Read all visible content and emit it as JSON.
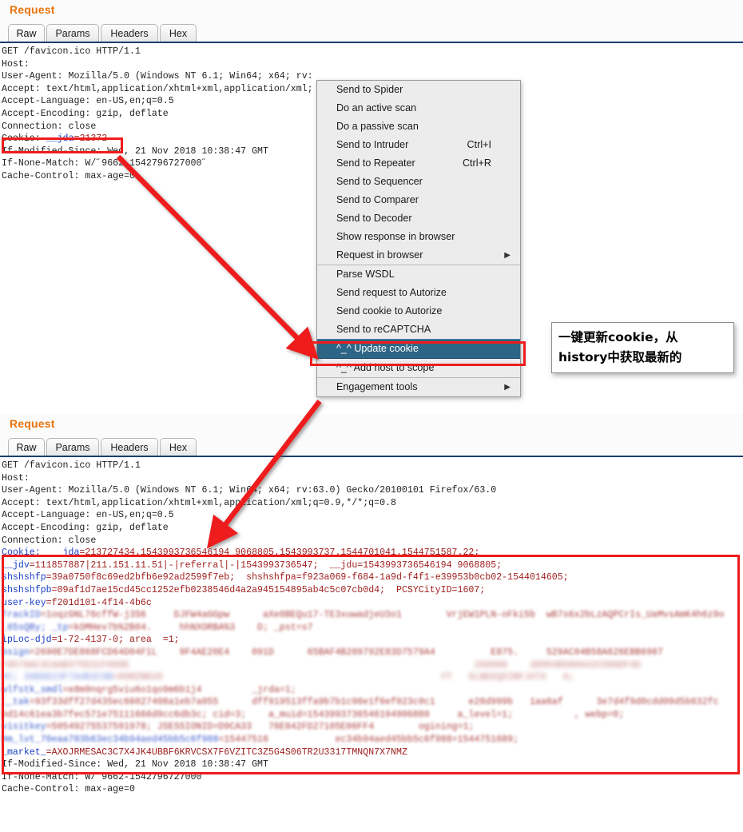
{
  "panels": {
    "top": {
      "title": "Request",
      "tabs": [
        {
          "label": "Raw",
          "active": true
        },
        {
          "label": "Params",
          "active": false
        },
        {
          "label": "Headers",
          "active": false
        },
        {
          "label": "Hex",
          "active": false
        }
      ],
      "raw_lines": [
        "GET /favicon.ico HTTP/1.1",
        "Host:",
        "User-Agent: Mozilla/5.0 (Windows NT 6.1; Win64; x64; rv:",
        "Accept: text/html,application/xhtml+xml,application/xml;",
        "Accept-Language: en-US,en;q=0.5",
        "Accept-Encoding: gzip, deflate",
        "Connection: close"
      ],
      "cookie_label": "Cookie: ",
      "cookie_name": "__jda",
      "cookie_eq": "=",
      "cookie_value": "21372",
      "tail_lines": [
        "If-Modified-Since: Wed, 21 Nov 2018 10:38:47 GMT",
        "If-None-Match: W/˝9662-1542796727000˝",
        "Cache-Control: max-age=0"
      ]
    },
    "bottom": {
      "title": "Request",
      "tabs": [
        {
          "label": "Raw",
          "active": true
        },
        {
          "label": "Params",
          "active": false
        },
        {
          "label": "Headers",
          "active": false
        },
        {
          "label": "Hex",
          "active": false
        }
      ],
      "raw_lines": [
        "GET /favicon.ico HTTP/1.1",
        "Host:",
        "User-Agent: Mozilla/5.0 (Windows NT 6.1; Win64; x64; rv:63.0) Gecko/20100101 Firefox/63.0",
        "Accept: text/html,application/xhtml+xml,application/xml;q=0.9,*/*;q=0.8",
        "Accept-Language: en-US,en;q=0.5",
        "Accept-Encoding: gzip, deflate",
        "Connection: close"
      ],
      "cookie_lines": [
        "Cookie:  __jda=213727434.1543993736546194 9068805.1543993737.1544701041.1544751587.22;",
        "__jdv=111857887|211.151.11.51|-|referral|-|1543993736547;  __jdu=1543993736546194 9068805;",
        "shshshfp=39a0750f8c69ed2bfb6e92ad2599f7eb;  shshshfpa=f923a069-f684-1a9d-f4f1-e39953b0cb02-1544014605;",
        "shshshfpb=09af1d7ae15cd45cc1252efb0238546d4a2a945154895ab4c5c07cb0d4;  PCSYCityID=1607;",
        "user-key=f201d101-4f14-4b6c",
        "TrackID=1oqzGNL76cffW-j3S6     DJFW4aGGpw      aXe8BEQu17-TE3xuwadjeU3o1        VrjEW1PLN-oFki5b  wB7s6x2bLzAQPCrIs_UaMvsAmK4h6z9o",
        "_65sQBy; _tp=kOMHev7b%2B04.     hhNXORBA%3    D; _pst=s7",
        "ipLoc-djd=1-72-4137-0; area  =1;",
        "bsign=2690E7DE868FCD64D04F1L    9F4AE20E4    091D      65BAF4B209792E83D7579A4          E875.     529AC04B58A626EBB6987",
        "F8578AC3CAAB375D1CF668E                                                              268006    38004B580A42C50ADF4D",
        "8C; 3AB9D23F7A4B3C9B=0SRZNEUX                                                  YT   5LBEEQXIBFJXTX   A;",
        "wlfstk_smdl=e8m9nqrg5viu6o1qo9m6b1j4         _jrda=1;",
        "__tak=93f33dff27d435ec66027408a1eb7a055      dff919513ffa9b7b1c98e1f6ef023c0c1      e28d999b   1aa6af      3e7d4f9d0cdd09d5b632fc",
        "bd14c61ea3b7fec571e75111666d9cc6db3c; cid=3;    a_muid=1543993736546194906880     a_level=1;           , webp=0;",
        "visitkey=50549275537591978; JSESSIONID=D9CA33   76E842FD27105E06FF4        ogining=1;",
        "Hm_lvt_70eaa703b63ec34b94aed45bb5c6f988=15447516            ec34b94aed45bb5c6f988=1544751689;",
        "_market_=AXOJRMESAC3C7X4JK4UBBF6KRVCSX7F6VZITC3Z5G4S06TR2U3317TMNQN7X7NMZ"
      ],
      "tail_lines": [
        "If-Modified-Since: Wed, 21 Nov 2018 10:38:47 GMT",
        "If-None-Match: W/˝9662-1542796727000˝",
        "Cache-Control: max-age=0"
      ]
    }
  },
  "context_menu": {
    "items": [
      {
        "label": "Send to Spider",
        "accel": "",
        "submenu": false,
        "separator": false,
        "highlighted": false
      },
      {
        "label": "Do an active scan",
        "accel": "",
        "submenu": false,
        "separator": false,
        "highlighted": false
      },
      {
        "label": "Do a passive scan",
        "accel": "",
        "submenu": false,
        "separator": false,
        "highlighted": false
      },
      {
        "label": "Send to Intruder",
        "accel": "Ctrl+I",
        "submenu": false,
        "separator": false,
        "highlighted": false
      },
      {
        "label": "Send to Repeater",
        "accel": "Ctrl+R",
        "submenu": false,
        "separator": false,
        "highlighted": false
      },
      {
        "label": "Send to Sequencer",
        "accel": "",
        "submenu": false,
        "separator": false,
        "highlighted": false
      },
      {
        "label": "Send to Comparer",
        "accel": "",
        "submenu": false,
        "separator": false,
        "highlighted": false
      },
      {
        "label": "Send to Decoder",
        "accel": "",
        "submenu": false,
        "separator": false,
        "highlighted": false
      },
      {
        "label": "Show response in browser",
        "accel": "",
        "submenu": false,
        "separator": false,
        "highlighted": false
      },
      {
        "label": "Request in browser",
        "accel": "",
        "submenu": true,
        "separator": false,
        "highlighted": false
      },
      {
        "label": "Parse WSDL",
        "accel": "",
        "submenu": false,
        "separator": true,
        "highlighted": false
      },
      {
        "label": "Send request to Autorize",
        "accel": "",
        "submenu": false,
        "separator": false,
        "highlighted": false
      },
      {
        "label": "Send cookie to Autorize",
        "accel": "",
        "submenu": false,
        "separator": false,
        "highlighted": false
      },
      {
        "label": "Send to reCAPTCHA",
        "accel": "",
        "submenu": false,
        "separator": false,
        "highlighted": false
      },
      {
        "label": "^_^ Update cookie",
        "accel": "",
        "submenu": false,
        "separator": false,
        "highlighted": true
      },
      {
        "label": "^_^ Add host to scope",
        "accel": "",
        "submenu": false,
        "separator": false,
        "highlighted": false
      },
      {
        "label": "Engagement tools",
        "accel": "",
        "submenu": true,
        "separator": true,
        "highlighted": false
      }
    ],
    "submenu_glyph": "▶",
    "highlight_color": "#2d6586"
  },
  "annotation": {
    "note_lines": [
      "一键更新cookie，从",
      "history中获取最新的"
    ],
    "highlight_color": "#ee1c1c",
    "arrow_color": "#ee1c1c"
  }
}
